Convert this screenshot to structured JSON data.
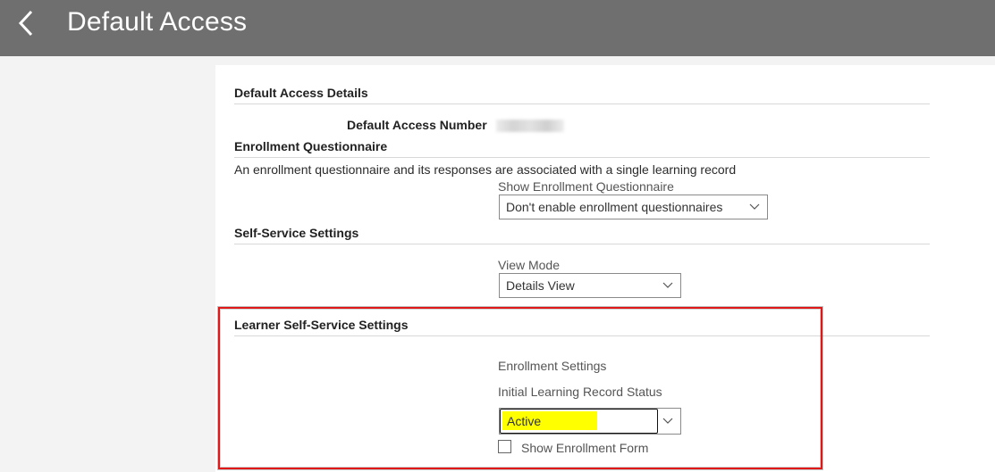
{
  "header": {
    "title": "Default Access",
    "back_icon": "chevron-left-icon"
  },
  "sections": {
    "default_access_details": {
      "title": "Default Access Details",
      "number_label": "Default Access Number"
    },
    "enrollment_questionnaire": {
      "title": "Enrollment Questionnaire",
      "description": "An enrollment questionnaire and its responses are associated with a single learning record",
      "field_label": "Show Enrollment Questionnaire",
      "selected_value": "Don't enable enrollment questionnaires"
    },
    "self_service": {
      "title": "Self-Service Settings",
      "field_label": "View Mode",
      "selected_value": "Details View"
    },
    "learner_self_service": {
      "title": "Learner Self-Service Settings",
      "subheading": "Enrollment Settings",
      "field_label": "Initial Learning Record Status",
      "selected_value": "Active",
      "checkbox_label": "Show Enrollment Form",
      "checkbox_checked": false
    }
  },
  "colors": {
    "header_bg": "#6f6f6f",
    "highlight": "#ffff00",
    "annotation_border": "#e01818"
  }
}
